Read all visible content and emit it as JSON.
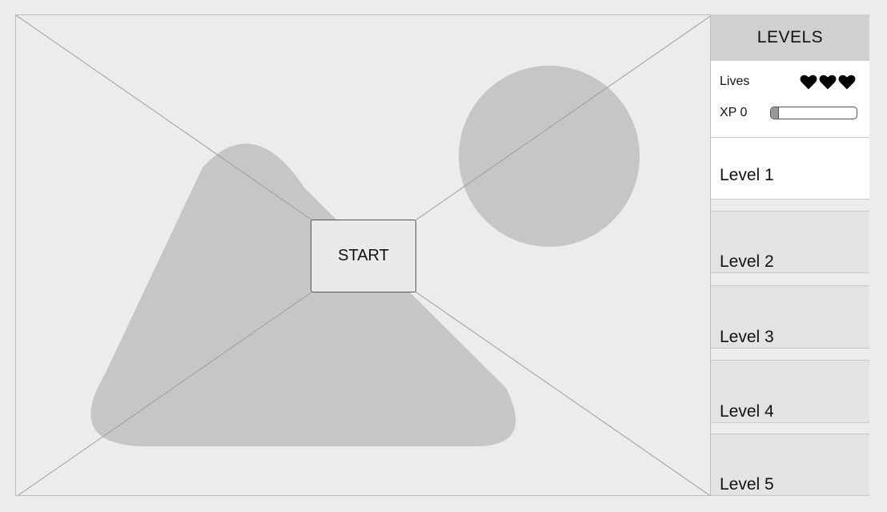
{
  "game": {
    "start_label": "START"
  },
  "sidebar": {
    "title": "LEVELS",
    "lives_label": "Lives",
    "lives_count": 3,
    "xp_label": "XP 0",
    "xp_progress": 0.0,
    "levels": [
      {
        "label": "Level 1",
        "active": true
      },
      {
        "label": "Level 2",
        "active": false
      },
      {
        "label": "Level 3",
        "active": false
      },
      {
        "label": "Level 4",
        "active": false
      },
      {
        "label": "Level 5",
        "active": false
      }
    ]
  },
  "colors": {
    "background": "#ececec",
    "placeholder_shape": "#c6c6c6",
    "header": "#d0d0d0",
    "level_active": "#ffffff",
    "level_inactive": "#e3e3e3",
    "heart": "#000000"
  }
}
